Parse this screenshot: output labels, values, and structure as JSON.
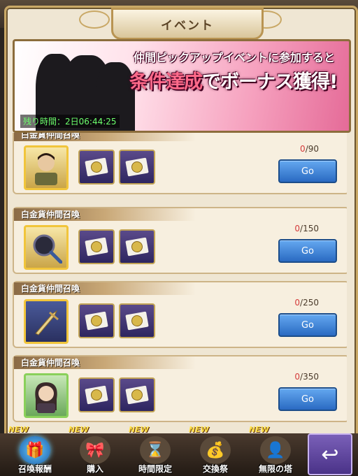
{
  "window": {
    "title": "イベント"
  },
  "banner": {
    "line1": "仲間ピックアップイベントに参加すると",
    "line2_highlight": "条件達成",
    "line2_rest": "でボーナス獲得!",
    "timer": "残り時間：2日06:44:25"
  },
  "missions": [
    {
      "title": "白金貨仲間召喚",
      "reward_icon": "portrait-man-icon",
      "progress": "0",
      "target": "/90",
      "button": "Go"
    },
    {
      "title": "白金貨仲間召喚",
      "reward_icon": "frying-pan-icon",
      "progress": "0",
      "target": "/150",
      "button": "Go"
    },
    {
      "title": "白金貨仲間召喚",
      "reward_icon": "dagger-icon",
      "progress": "0",
      "target": "/250",
      "button": "Go"
    },
    {
      "title": "白金貨仲間召喚",
      "reward_icon": "portrait-woman-icon",
      "progress": "0",
      "target": "/350",
      "button": "Go"
    }
  ],
  "nav": [
    {
      "label": "召喚報酬",
      "badge": "NEW",
      "icon": "gift-hammer-icon"
    },
    {
      "label": "購入",
      "badge": "NEW",
      "icon": "gift-box-icon"
    },
    {
      "label": "時間限定",
      "badge": "NEW",
      "icon": "hourglass-icon"
    },
    {
      "label": "交換祭",
      "badge": "NEW",
      "icon": "treasure-chest-icon"
    },
    {
      "label": "無限の塔",
      "badge": "NEW",
      "icon": "character-avatar-icon"
    }
  ],
  "colors": {
    "accent": "#2a6ac2",
    "gold": "#c9a866",
    "timer": "#6dff6d",
    "new_badge": "#ffe14a"
  }
}
